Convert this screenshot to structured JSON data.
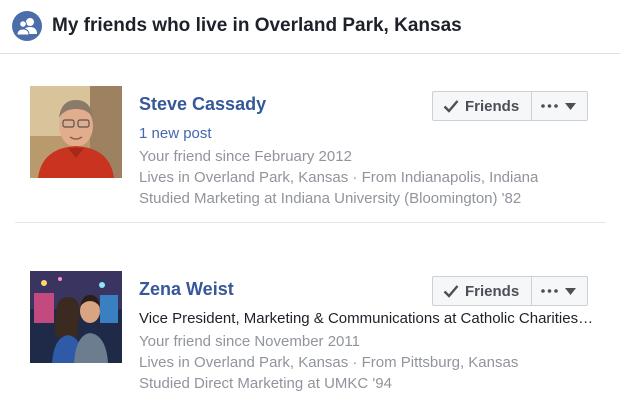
{
  "header": {
    "title": "My friends who live in Overland Park, Kansas",
    "icon": "friends-group-icon"
  },
  "colors": {
    "accent": "#4b6eaa",
    "link": "#365899",
    "secondary_text": "#90949c"
  },
  "friends": [
    {
      "name": "Steve Cassady",
      "new_post": "1 new post",
      "since": "Your friend since February 2012",
      "lives": "Lives in Overland Park, Kansas · From Indianapolis, Indiana",
      "studied": "Studied Marketing at Indiana University (Bloomington) '82",
      "friends_button": "Friends"
    },
    {
      "name": "Zena Weist",
      "work": "Vice President, Marketing & Communications at Catholic Charities of Northeast Kansas",
      "since": "Your friend since November 2011",
      "lives": "Lives in Overland Park, Kansas · From Pittsburg, Kansas",
      "studied": "Studied Direct Marketing at UMKC '94",
      "friends_button": "Friends"
    }
  ]
}
